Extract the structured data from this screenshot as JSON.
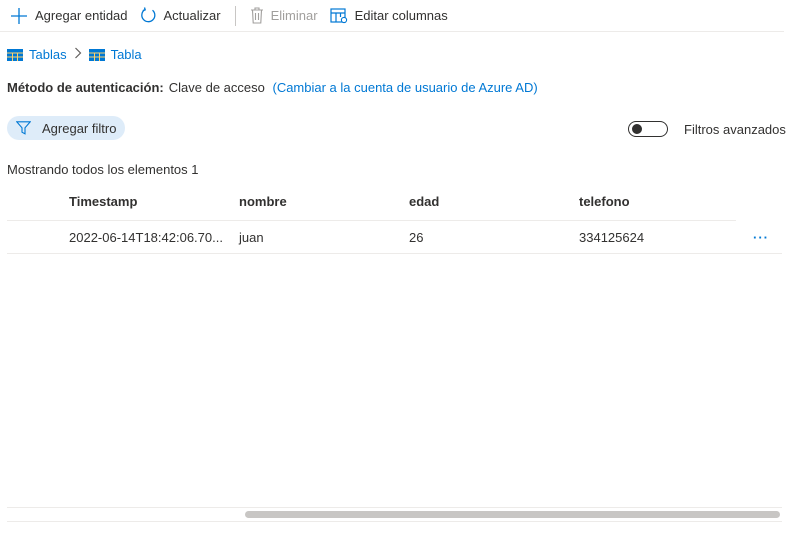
{
  "toolbar": {
    "add_entity": "Agregar entidad",
    "refresh": "Actualizar",
    "delete": "Eliminar",
    "edit_columns": "Editar columnas"
  },
  "breadcrumb": {
    "tables": "Tablas",
    "table": "Tabla"
  },
  "auth": {
    "label": "Método de autenticación:",
    "value": "Clave de acceso",
    "switch_link": "(Cambiar a la cuenta de usuario de Azure AD)"
  },
  "filter": {
    "add_filter": "Agregar filtro",
    "advanced_label": "Filtros avanzados",
    "advanced_enabled": false
  },
  "status": {
    "count_text": "Mostrando todos los elementos 1"
  },
  "grid": {
    "columns": [
      "Timestamp",
      "nombre",
      "edad",
      "telefono"
    ],
    "rows": [
      [
        "2022-06-14T18:42:06.70...",
        "juan",
        "26",
        "334125624"
      ]
    ],
    "more_label": "···"
  },
  "colors": {
    "accent": "#0078d4",
    "pill_bg": "#deecf9"
  }
}
